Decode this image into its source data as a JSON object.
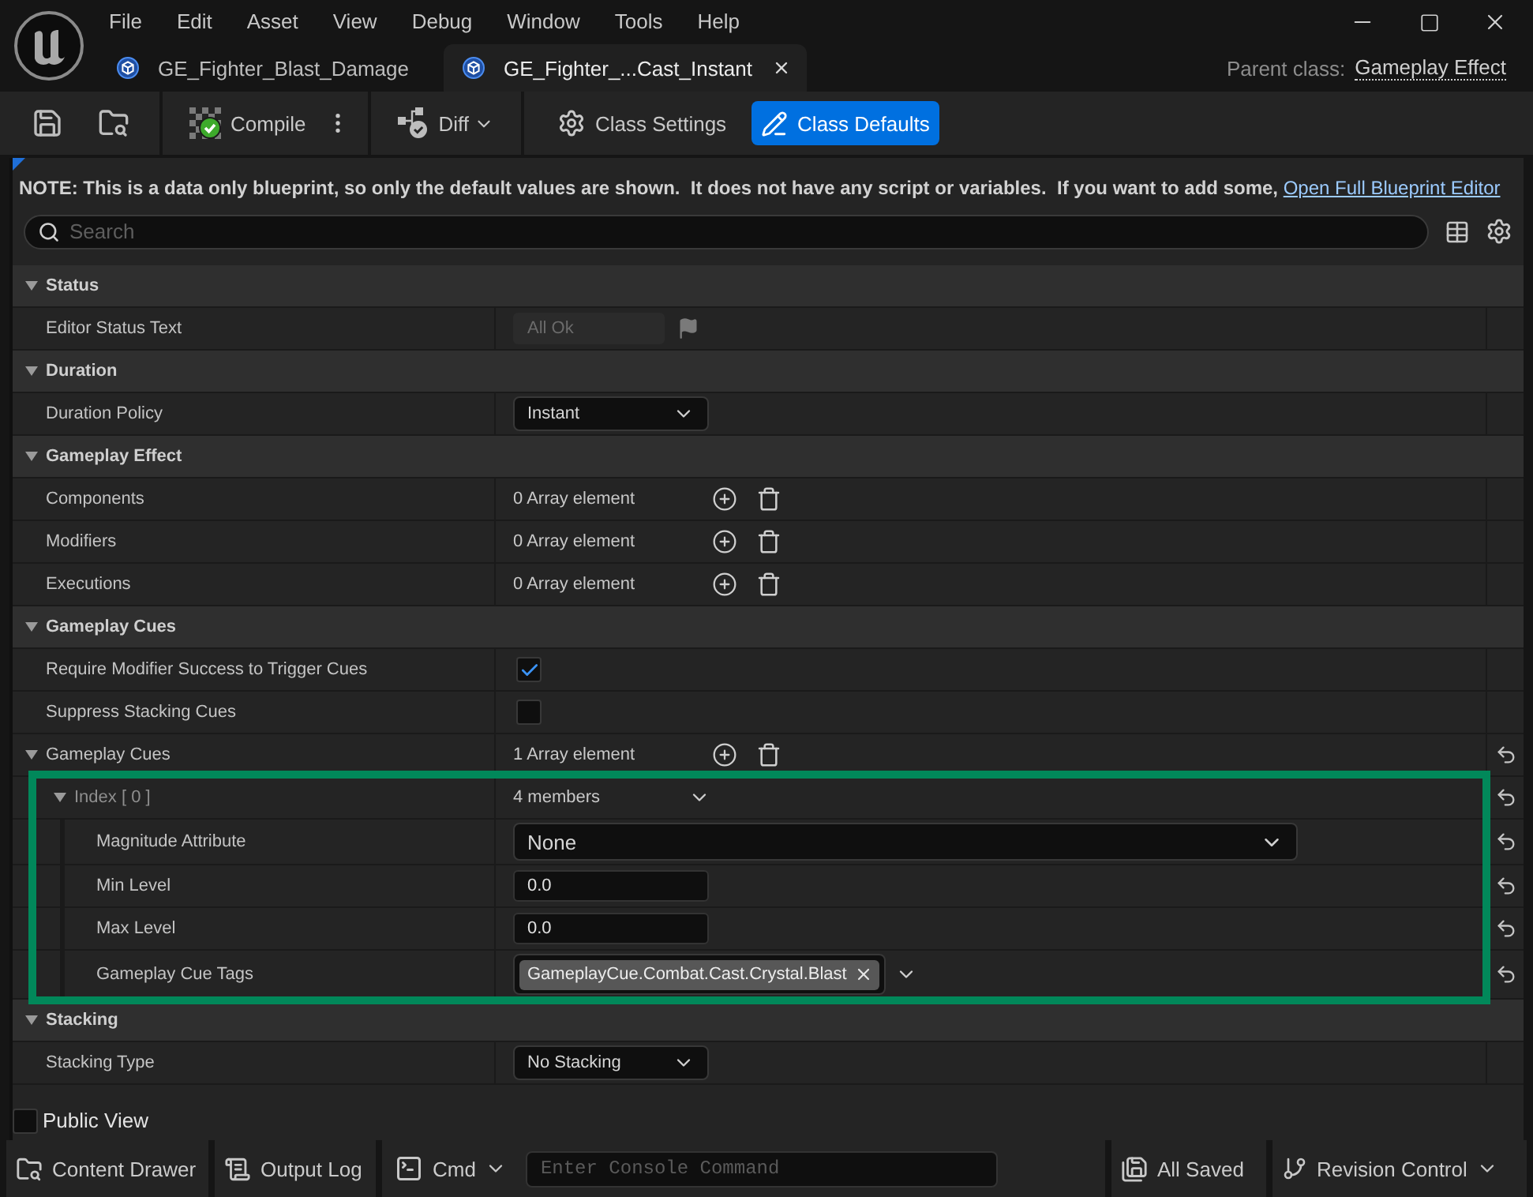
{
  "window": {
    "menu": [
      "File",
      "Edit",
      "Asset",
      "View",
      "Debug",
      "Window",
      "Tools",
      "Help"
    ]
  },
  "tabs": [
    {
      "label": "GE_Fighter_Blast_Damage",
      "selected": false
    },
    {
      "label": "GE_Fighter_...Cast_Instant",
      "selected": true
    }
  ],
  "parent_class": {
    "label": "Parent class:",
    "value": "Gameplay Effect"
  },
  "toolbar": {
    "compile": "Compile",
    "diff": "Diff",
    "modes": [
      {
        "label": "Class Settings",
        "selected": false
      },
      {
        "label": "Class Defaults",
        "selected": true
      }
    ]
  },
  "note": {
    "text": "NOTE: This is a data only blueprint, so only the default values are shown.  It does not have any script or variables.  If you want to add some, ",
    "link": "Open Full Blueprint Editor"
  },
  "search": {
    "placeholder": "Search"
  },
  "categories": [
    {
      "title": "Status",
      "expanded": true,
      "properties": [
        {
          "kind": "readonly",
          "label": "Editor Status Text",
          "value": "All Ok",
          "disabled": true,
          "modified": false
        }
      ]
    },
    {
      "title": "Duration",
      "expanded": true,
      "properties": [
        {
          "kind": "dropdown",
          "label": "Duration Policy",
          "value": "Instant",
          "modified": false
        }
      ]
    },
    {
      "title": "Gameplay Effect",
      "expanded": true,
      "properties": [
        {
          "kind": "array",
          "label": "Components",
          "value": "0 Array element",
          "modified": false
        },
        {
          "kind": "array",
          "label": "Modifiers",
          "value": "0 Array element",
          "modified": false
        },
        {
          "kind": "array",
          "label": "Executions",
          "value": "0 Array element",
          "modified": false
        }
      ]
    },
    {
      "title": "Gameplay Cues",
      "expanded": true,
      "properties": [
        {
          "kind": "checkbox",
          "label": "Require Modifier Success to Trigger Cues",
          "checked": true,
          "modified": false
        },
        {
          "kind": "checkbox",
          "label": "Suppress Stacking Cues",
          "checked": false,
          "modified": false
        },
        {
          "kind": "array",
          "label": "Gameplay Cues",
          "value": "1 Array element",
          "modified": true,
          "expanded": true,
          "children": [
            {
              "kind": "struct",
              "label": "Index [ 0 ]",
              "value": "4 members",
              "modified": true,
              "expanded": true,
              "highlighted": true,
              "children": [
                {
                  "kind": "combo",
                  "label": "Magnitude Attribute",
                  "value": "None",
                  "modified": true
                },
                {
                  "kind": "number",
                  "label": "Min Level",
                  "value": "0.0",
                  "modified": true
                },
                {
                  "kind": "number",
                  "label": "Max Level",
                  "value": "0.0",
                  "modified": true
                },
                {
                  "kind": "tags",
                  "label": "Gameplay Cue Tags",
                  "tags": [
                    "GameplayCue.Combat.Cast.Crystal.Blast"
                  ],
                  "modified": true
                }
              ]
            }
          ]
        }
      ]
    },
    {
      "title": "Stacking",
      "expanded": true,
      "properties": [
        {
          "kind": "dropdown",
          "label": "Stacking Type",
          "value": "No Stacking",
          "modified": false
        }
      ]
    }
  ],
  "public_view": {
    "label": "Public View",
    "checked": false
  },
  "status_bar": {
    "content_drawer": "Content Drawer",
    "output_log": "Output Log",
    "cmd": "Cmd",
    "console": {
      "placeholder": "Enter Console Command"
    },
    "save_status": "All Saved",
    "revision_control": "Revision Control"
  }
}
